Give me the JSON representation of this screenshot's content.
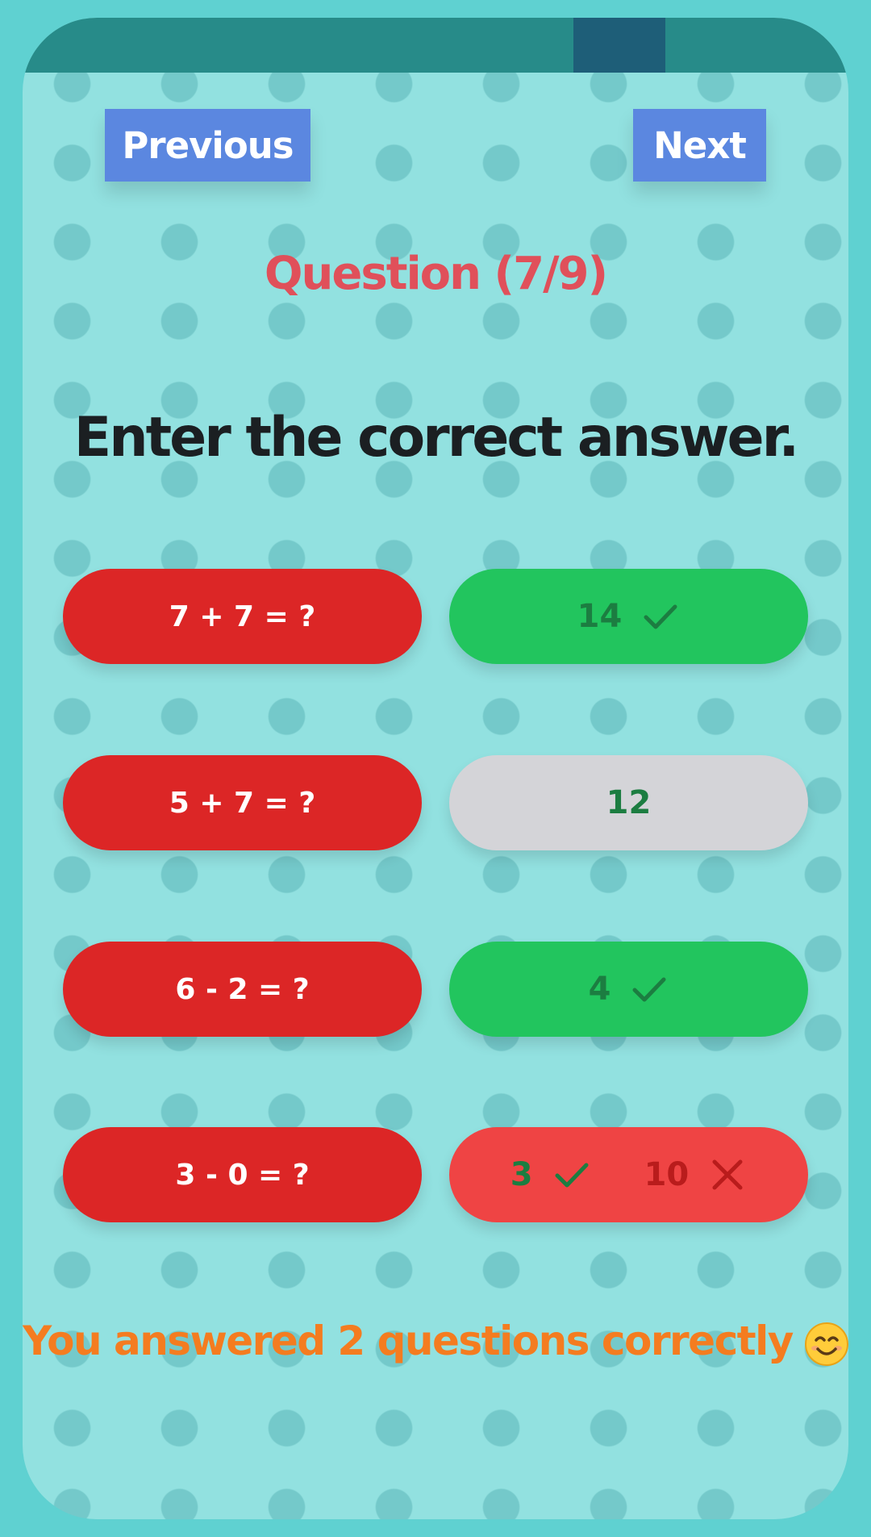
{
  "progress": {
    "fraction": 0.111,
    "start_fraction": 0.667
  },
  "nav": {
    "previous_label": "Previous",
    "next_label": "Next"
  },
  "question_counter": "Question (7/9)",
  "instruction": "Enter the correct answer.",
  "rows": [
    {
      "question": "7 + 7 = ?",
      "answer": "14",
      "state": "correct",
      "icon": "check-icon"
    },
    {
      "question": "5 + 7 = ?",
      "answer": "12",
      "state": "unanswered"
    },
    {
      "question": "6 - 2 = ?",
      "answer": "4",
      "state": "correct",
      "icon": "check-icon"
    },
    {
      "question": "3 - 0 = ?",
      "answer": "3",
      "wrong_answer": "10",
      "state": "wrong",
      "icons": [
        "check-icon",
        "x-icon"
      ]
    }
  ],
  "result_text": "You answered 2 questions correctly",
  "result_emoji": "smiling-face-icon",
  "colors": {
    "question_pill": "#dc2626",
    "correct_pill": "#22c55e",
    "neutral_pill": "#d4d4d8",
    "wrong_pill": "#ef4444",
    "nav_button": "#5b87e0",
    "counter_text": "#e0505a",
    "result_text": "#f47c20"
  }
}
